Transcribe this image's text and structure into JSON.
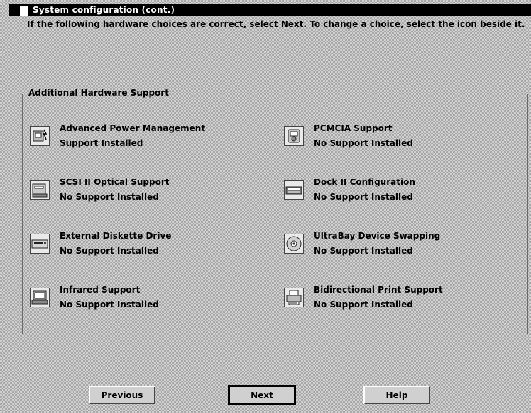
{
  "window": {
    "title": "System configuration (cont.)",
    "instructions": "If the following hardware choices are correct, select Next. To change a choice, select the icon beside it."
  },
  "group": {
    "label": "Additional Hardware Support"
  },
  "items": [
    {
      "name": "Advanced Power Management",
      "status": "Support Installed",
      "icon": "power-management-icon"
    },
    {
      "name": "PCMCIA Support",
      "status": "No Support Installed",
      "icon": "pcmcia-icon"
    },
    {
      "name": "SCSI II Optical Support",
      "status": "No Support Installed",
      "icon": "scsi-optical-icon"
    },
    {
      "name": "Dock II Configuration",
      "status": "No Support Installed",
      "icon": "dock-icon"
    },
    {
      "name": "External Diskette Drive",
      "status": "No Support Installed",
      "icon": "diskette-drive-icon"
    },
    {
      "name": "UltraBay Device Swapping",
      "status": "No Support Installed",
      "icon": "ultrabay-icon"
    },
    {
      "name": "Infrared Support",
      "status": "No Support Installed",
      "icon": "infrared-icon"
    },
    {
      "name": "Bidirectional Print Support",
      "status": "No Support Installed",
      "icon": "printer-icon"
    }
  ],
  "buttons": {
    "previous": "Previous",
    "next": "Next",
    "help": "Help"
  }
}
